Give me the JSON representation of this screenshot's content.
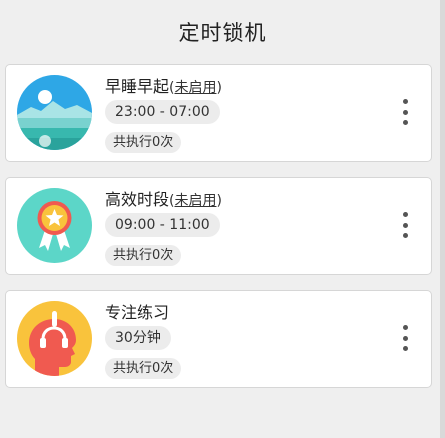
{
  "header": {
    "title": "定时锁机"
  },
  "cards": [
    {
      "name": "早睡早起",
      "status_open": "(",
      "status": "未启用",
      "status_close": ")",
      "time": "23:00 - 07:00",
      "count": "共执行0次",
      "icon": "landscape-sun-icon"
    },
    {
      "name": "高效时段",
      "status_open": "(",
      "status": "未启用",
      "status_close": ")",
      "time": "09:00 - 11:00",
      "count": "共执行0次",
      "icon": "award-ribbon-icon"
    },
    {
      "name": "专注练习",
      "time": "30分钟",
      "count": "共执行0次",
      "icon": "head-headphones-icon"
    }
  ],
  "colors": {
    "background": "#efefef",
    "card": "#ffffff",
    "pill": "#ececec",
    "teal": "#5cd6c8",
    "yellow": "#f9c33c",
    "red": "#f05a50",
    "sky": "#2ea7e6"
  }
}
